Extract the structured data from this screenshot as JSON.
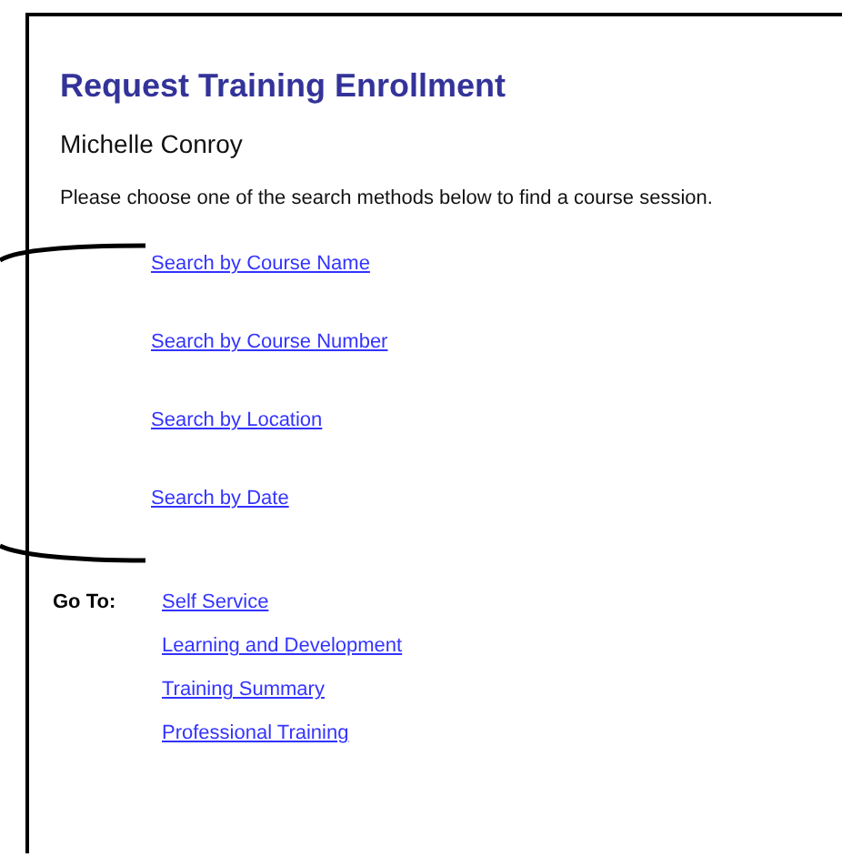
{
  "page": {
    "title": "Request Training Enrollment",
    "user_name": "Michelle Conroy",
    "instructions": "Please choose one of the search methods below to find a course session."
  },
  "search_links": [
    "Search by Course Name",
    "Search by Course Number",
    "Search by Location",
    "Search by Date"
  ],
  "go_to": {
    "label": "Go To:",
    "links": [
      "Self Service",
      "Learning and Development",
      "Training Summary",
      "Professional Training"
    ]
  }
}
